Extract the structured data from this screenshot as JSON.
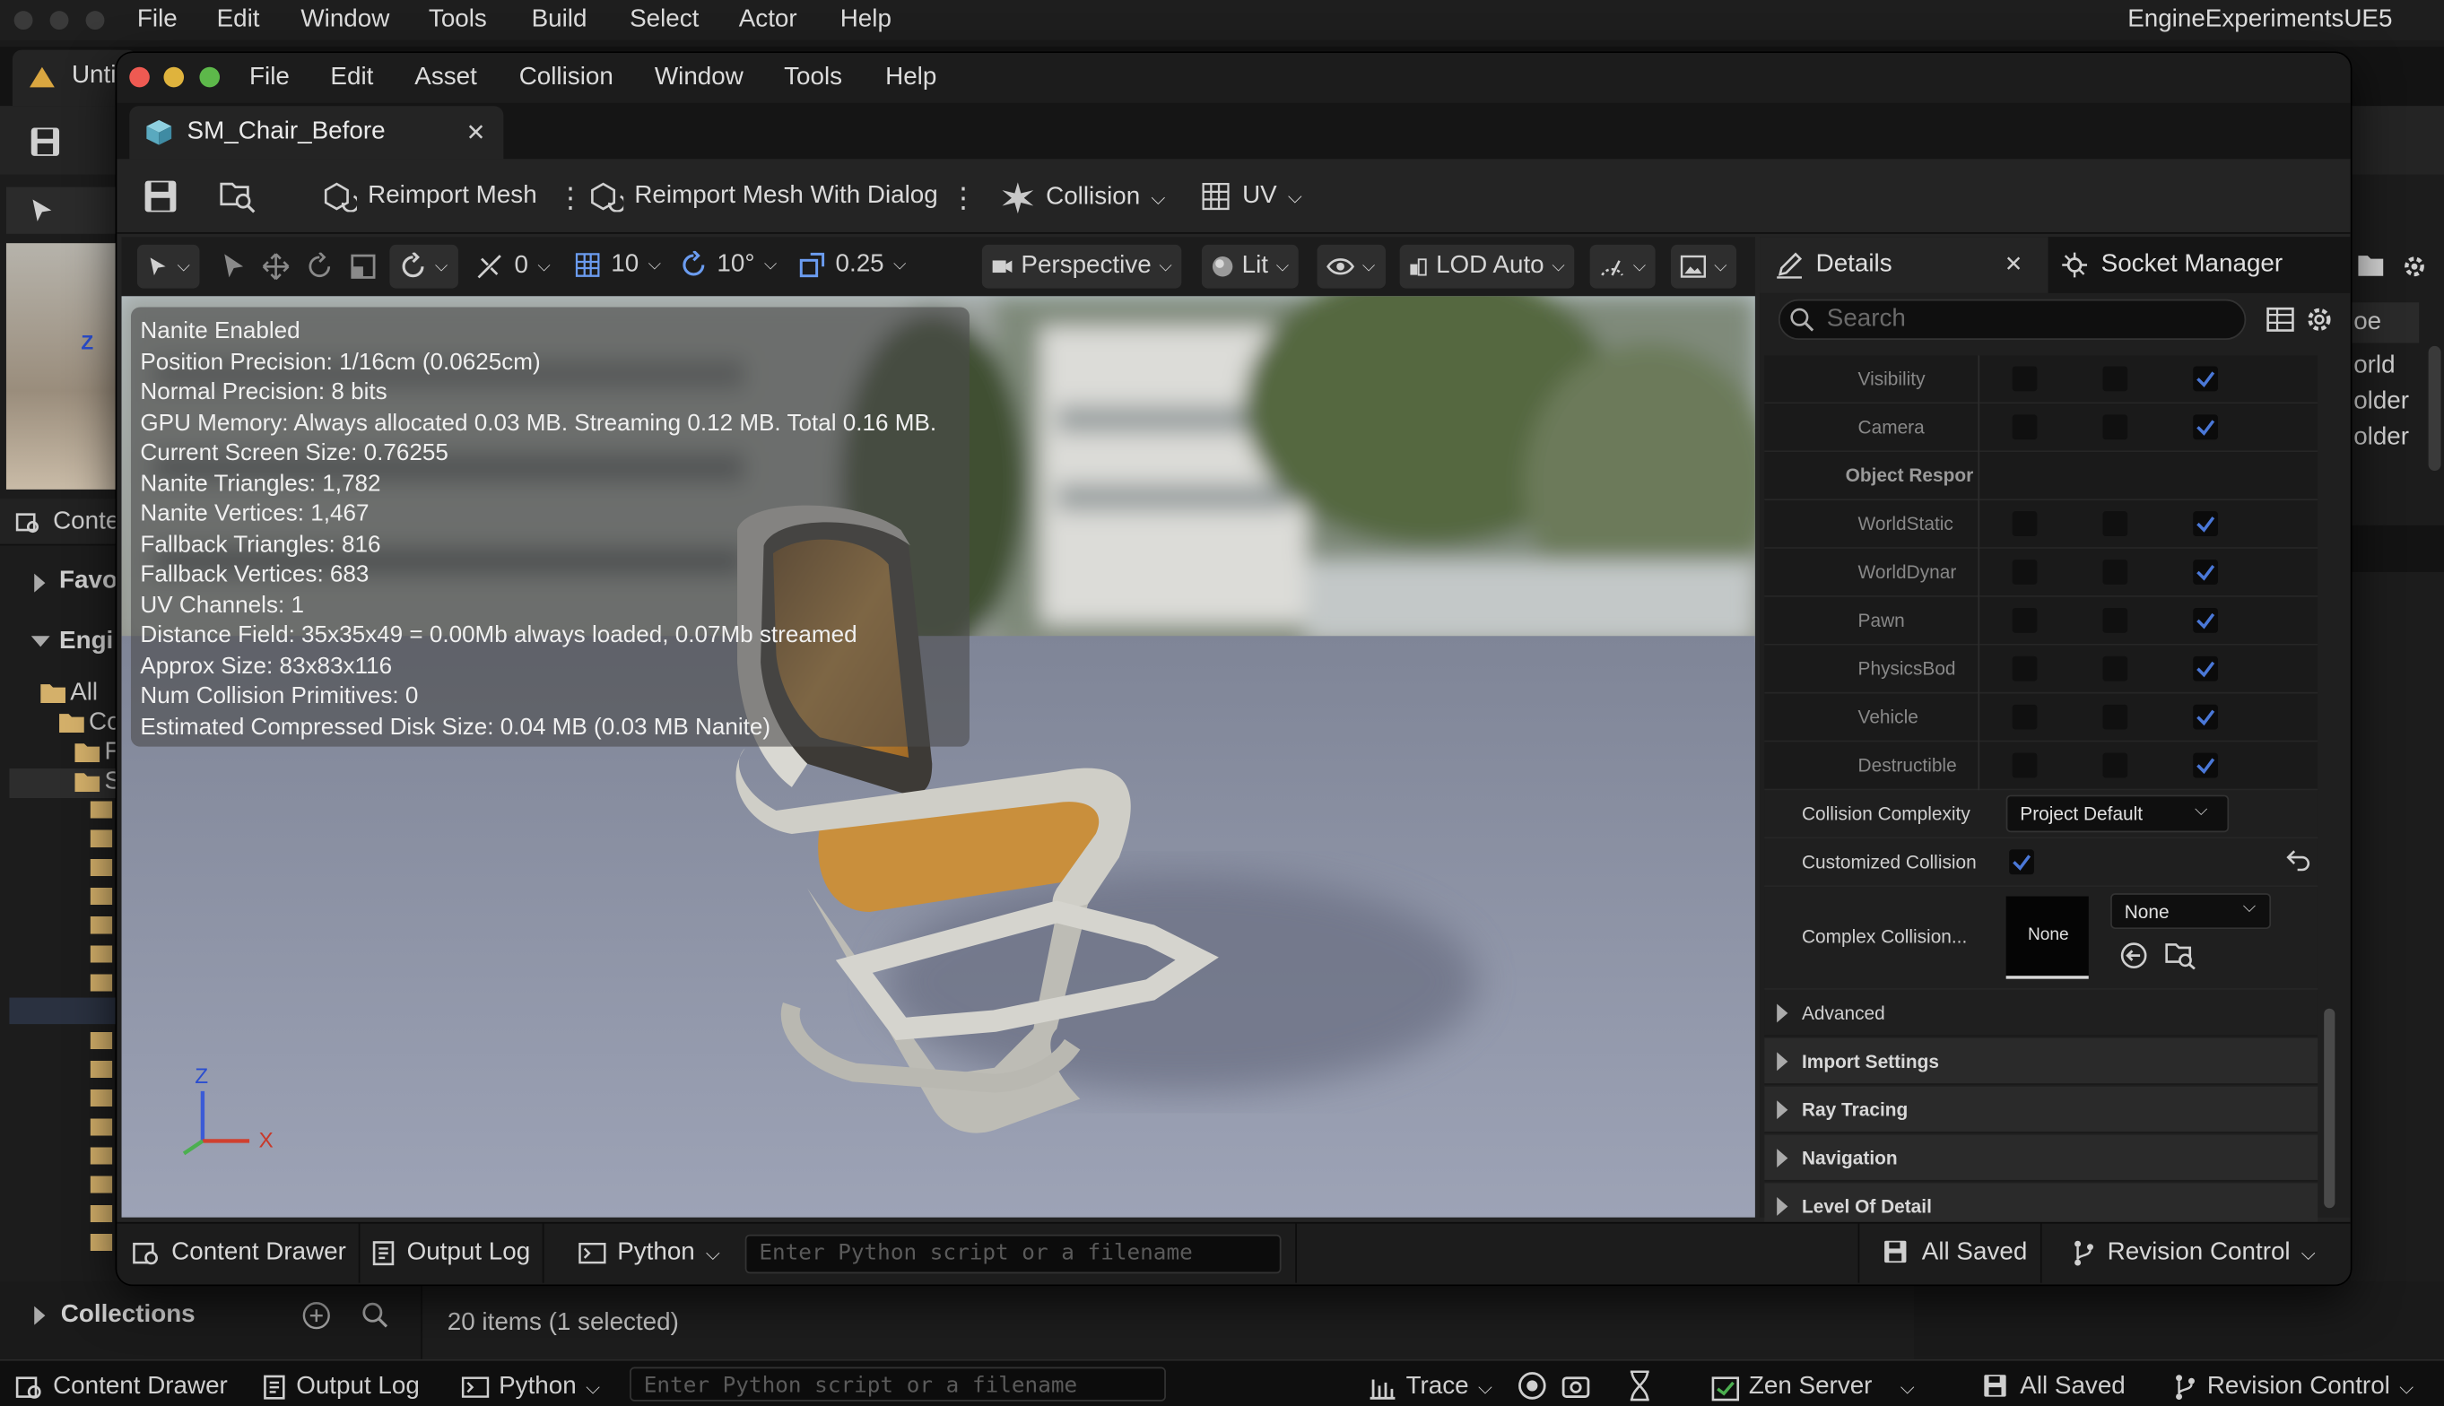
{
  "outer_menu": {
    "items": [
      "File",
      "Edit",
      "Window",
      "Tools",
      "Build",
      "Select",
      "Actor",
      "Help"
    ],
    "project_name": "EngineExperimentsUE5"
  },
  "back_editor": {
    "tab_label": "Unti",
    "content_label": "Conte",
    "tree": [
      "Favo",
      "Engi",
      "All",
      "Co",
      "F",
      "S"
    ],
    "right_items": [
      "oe",
      "orld",
      "older",
      "older"
    ],
    "collections_label": "Collections",
    "items_count": "20 items (1 selected)"
  },
  "status_bar": {
    "content_drawer": "Content Drawer",
    "output_log": "Output Log",
    "python": "Python",
    "python_placeholder": "Enter Python script or a filename",
    "trace": "Trace",
    "zen_server": "Zen Server",
    "all_saved": "All Saved",
    "revision_control": "Revision Control"
  },
  "window": {
    "menu": [
      "File",
      "Edit",
      "Asset",
      "Collision",
      "Window",
      "Tools",
      "Help"
    ],
    "asset_tab": "SM_Chair_Before",
    "toolbar": {
      "reimport": "Reimport Mesh",
      "reimport_dialog": "Reimport Mesh With Dialog",
      "collision": "Collision",
      "uv": "UV"
    },
    "viewport_toolbar": {
      "angle_snap": "0",
      "grid_snap": "10",
      "rot_snap": "10°",
      "scale_snap": "0.25",
      "perspective": "Perspective",
      "lit": "Lit",
      "lod": "LOD Auto"
    },
    "stats": [
      "Nanite Enabled",
      "Position Precision: 1/16cm (0.0625cm)",
      "Normal Precision: 8 bits",
      "GPU Memory: Always allocated 0.03 MB. Streaming 0.12 MB. Total 0.16 MB.",
      "Current Screen Size: 0.76255",
      "Nanite Triangles: 1,782",
      "Nanite Vertices: 1,467",
      "Fallback Triangles: 816",
      "Fallback Vertices: 683",
      "UV Channels: 1",
      "Distance Field: 35x35x49 = 0.00Mb always loaded, 0.07Mb streamed",
      "Approx Size: 83x83x116",
      "Num Collision Primitives: 0",
      "Estimated Compressed Disk Size: 0.04 MB (0.03 MB Nanite)"
    ],
    "axis": {
      "z": "Z",
      "x": "X"
    },
    "details": {
      "tab_details": "Details",
      "tab_socket": "Socket Manager",
      "search_placeholder": "Search",
      "rows": [
        {
          "label": "Visibility",
          "checks": [
            false,
            false,
            true
          ]
        },
        {
          "label": "Camera",
          "checks": [
            false,
            false,
            true
          ]
        },
        {
          "label": "Object Respor",
          "header": true
        },
        {
          "label": "WorldStatic",
          "checks": [
            false,
            false,
            true
          ]
        },
        {
          "label": "WorldDynar",
          "checks": [
            false,
            false,
            true
          ]
        },
        {
          "label": "Pawn",
          "checks": [
            false,
            false,
            true
          ]
        },
        {
          "label": "PhysicsBod",
          "checks": [
            false,
            false,
            true
          ]
        },
        {
          "label": "Vehicle",
          "checks": [
            false,
            false,
            true
          ]
        },
        {
          "label": "Destructible",
          "checks": [
            false,
            false,
            true
          ]
        }
      ],
      "collision_complexity_label": "Collision Complexity",
      "collision_complexity_value": "Project Default",
      "customized_collision_label": "Customized Collision",
      "complex_collision_label": "Complex Collision...",
      "complex_thumb": "None",
      "complex_dropdown": "None",
      "sections": [
        "Advanced",
        "Import Settings",
        "Ray Tracing",
        "Navigation",
        "Level Of Detail"
      ]
    },
    "bottom": {
      "content_drawer": "Content Drawer",
      "output_log": "Output Log",
      "python": "Python",
      "python_placeholder": "Enter Python script or a filename",
      "all_saved": "All Saved",
      "revision_control": "Revision Control"
    }
  }
}
